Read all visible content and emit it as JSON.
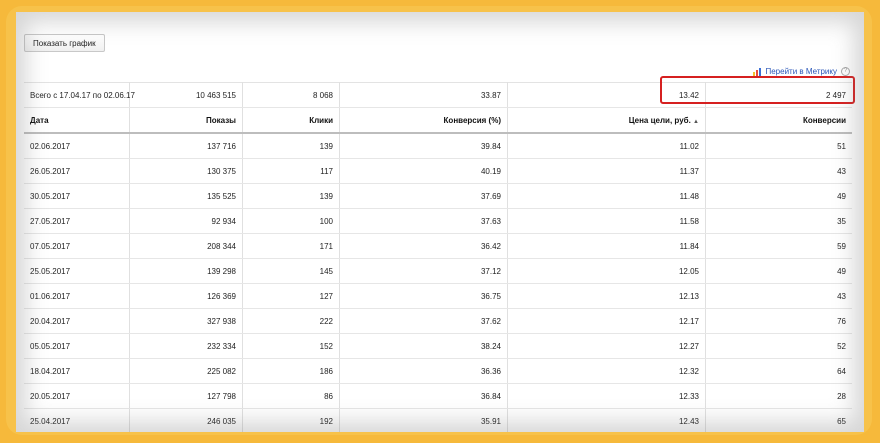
{
  "toolbar": {
    "show_chart_label": "Показать график"
  },
  "metrika": {
    "link_label": "Перейти в Метрику",
    "help_glyph": "?"
  },
  "summary": {
    "label": "Всего с 17.04.17 по 02.06.17",
    "impressions": "10 463 515",
    "clicks": "8 068",
    "conversion_rate": "33.87",
    "goal_price": "13.42",
    "conversions": "2 497"
  },
  "table": {
    "columns": [
      "Дата",
      "Показы",
      "Клики",
      "Конверсия (%)",
      "Цена цели, руб.",
      "Конверсии"
    ],
    "sort_indicator": "▲",
    "rows": [
      [
        "02.06.2017",
        "137 716",
        "139",
        "39.84",
        "11.02",
        "51"
      ],
      [
        "26.05.2017",
        "130 375",
        "117",
        "40.19",
        "11.37",
        "43"
      ],
      [
        "30.05.2017",
        "135 525",
        "139",
        "37.69",
        "11.48",
        "49"
      ],
      [
        "27.05.2017",
        "92 934",
        "100",
        "37.63",
        "11.58",
        "35"
      ],
      [
        "07.05.2017",
        "208 344",
        "171",
        "36.42",
        "11.84",
        "59"
      ],
      [
        "25.05.2017",
        "139 298",
        "145",
        "37.12",
        "12.05",
        "49"
      ],
      [
        "01.06.2017",
        "126 369",
        "127",
        "36.75",
        "12.13",
        "43"
      ],
      [
        "20.04.2017",
        "327 938",
        "222",
        "37.62",
        "12.17",
        "76"
      ],
      [
        "05.05.2017",
        "232 334",
        "152",
        "38.24",
        "12.27",
        "52"
      ],
      [
        "18.04.2017",
        "225 082",
        "186",
        "36.36",
        "12.32",
        "64"
      ],
      [
        "20.05.2017",
        "127 798",
        "86",
        "36.84",
        "12.33",
        "28"
      ],
      [
        "25.04.2017",
        "246 035",
        "192",
        "35.91",
        "12.43",
        "65"
      ]
    ]
  },
  "colors": {
    "frame": "#f6b93b",
    "highlight": "#d62020",
    "link": "#2a56b8"
  }
}
